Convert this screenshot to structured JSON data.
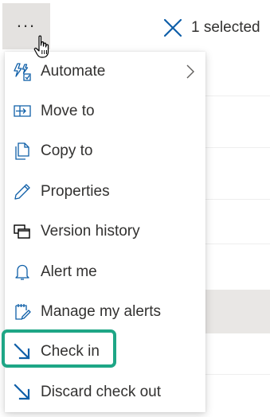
{
  "toolbar": {
    "more_actions_label": "...",
    "selection": {
      "close_icon": "close-icon",
      "text": "1 selected"
    }
  },
  "menu": {
    "items": [
      {
        "label": "Automate",
        "icon": "automate-icon",
        "has_submenu": true
      },
      {
        "label": "Move to",
        "icon": "move-to-icon"
      },
      {
        "label": "Copy to",
        "icon": "copy-to-icon"
      },
      {
        "label": "Properties",
        "icon": "pencil-icon"
      },
      {
        "label": "Version history",
        "icon": "version-history-icon"
      },
      {
        "label": "Alert me",
        "icon": "bell-icon"
      },
      {
        "label": "Manage my alerts",
        "icon": "manage-alerts-icon"
      },
      {
        "label": "Check in",
        "icon": "check-in-arrow-icon",
        "highlighted": true
      },
      {
        "label": "Discard check out",
        "icon": "discard-check-out-arrow-icon"
      }
    ],
    "highlight_color": "#1ea686",
    "accent_color": "#0f5fa8"
  }
}
